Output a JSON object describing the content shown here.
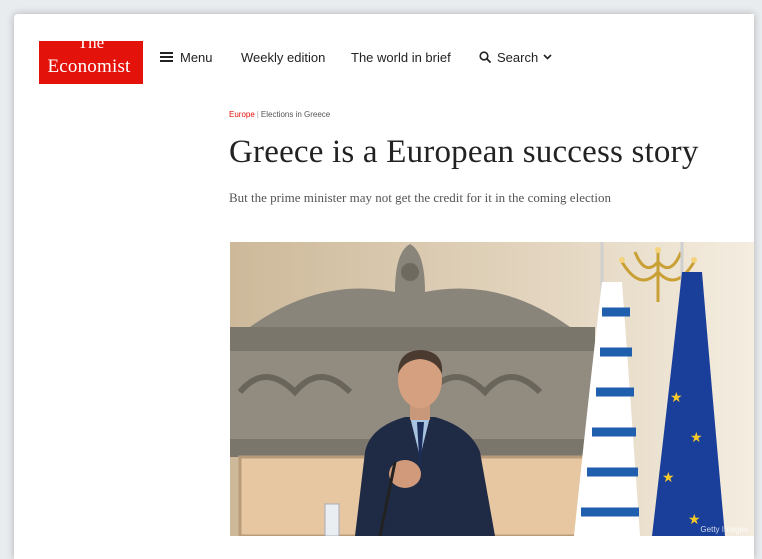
{
  "logo": {
    "line1": "The",
    "line2": "Economist"
  },
  "nav": {
    "menu_label": "Menu",
    "weekly_label": "Weekly edition",
    "brief_label": "The world in brief",
    "search_label": "Search"
  },
  "breadcrumb": {
    "section": "Europe",
    "separator": "|",
    "topic": "Elections in Greece"
  },
  "article": {
    "headline": "Greece is a European success story",
    "subheadline": "But the prime minister may not get the credit for it in the coming election",
    "photo_credit": "Getty Images"
  },
  "colors": {
    "brand_red": "#e3120b",
    "text": "#222222"
  },
  "icons": [
    "menu-icon",
    "search-icon",
    "chevron-down-icon"
  ]
}
